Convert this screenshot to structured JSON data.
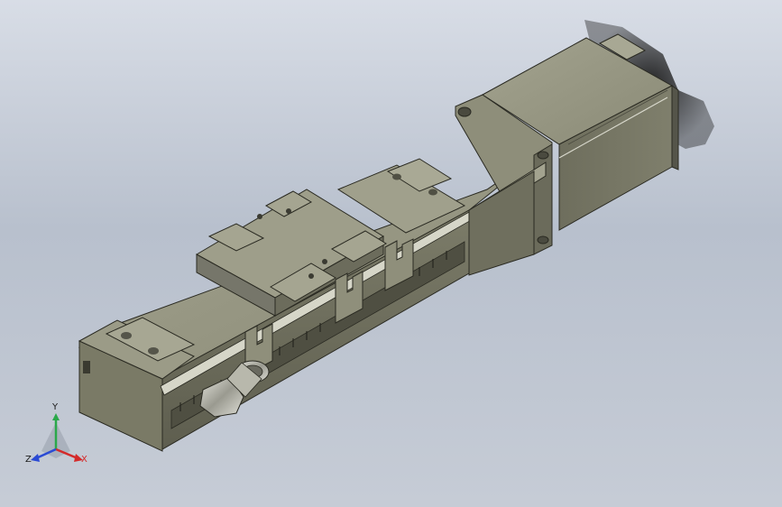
{
  "view": {
    "background_top": "#d8dde6",
    "background_bottom": "#c6ccd6",
    "model_color": "#8c8c78",
    "model_edge": "#2a2a22"
  },
  "triad": {
    "x_label": "X",
    "y_label": "Y",
    "z_label": "Z",
    "x_color": "#d42a2a",
    "y_color": "#2aa84a",
    "z_color": "#2a4ad4"
  }
}
